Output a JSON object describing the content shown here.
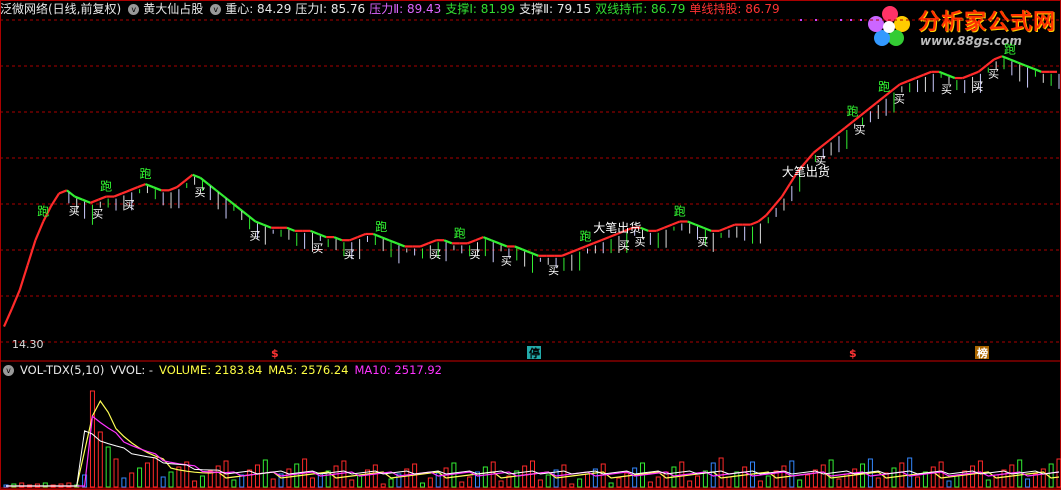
{
  "header": {
    "network_label": "泛微网络(日线,前复权)",
    "indicator_name": "黄大仙占股",
    "center_label": "重心: 84.29",
    "press1_label": "压力Ⅰ: 85.76",
    "press2_label": "压力Ⅱ: 89.43",
    "support1_label": "支撑Ⅰ: 81.99",
    "support2_label": "支撑Ⅱ: 79.15",
    "double_hold_label": "双线持币: 86.79",
    "single_hold_label": "单线持股: 86.79"
  },
  "logo": {
    "title": "分析家公式网",
    "url": "www.88gs.com"
  },
  "price_low_label": "14.30",
  "volume": {
    "name": "VOL-TDX(5,10)",
    "vvol": "VVOL: -",
    "volume_label": "VOLUME: 2183.84",
    "ma5_label": "MA5: 2576.24",
    "ma10_label": "MA10: 2517.92"
  },
  "markers": {
    "dollar": "$",
    "stop": "停",
    "rank": "榜"
  },
  "colors": {
    "up": "#ff2a2a",
    "down": "#33ee33",
    "ma_white": "#ffffff",
    "ma_yellow": "#ffff55",
    "ma_magenta": "#ff33ff",
    "grid": "#aa0000"
  },
  "chart_data": [
    {
      "type": "line",
      "title": "黄大仙占股",
      "ylabel": "",
      "series": [
        {
          "name": "黄大仙占股",
          "values": [
            14.3,
            20,
            26,
            34,
            42,
            48,
            53,
            57,
            58,
            56,
            55,
            54,
            55,
            56,
            56,
            57,
            58,
            59,
            60,
            59,
            58,
            58,
            59,
            61,
            63,
            62,
            60,
            58,
            56,
            54,
            52,
            50,
            48,
            47,
            46,
            46,
            46,
            45,
            45,
            45,
            44,
            43,
            43,
            42,
            42,
            43,
            44,
            44,
            43,
            42,
            41,
            40,
            40,
            40,
            41,
            42,
            42,
            41,
            41,
            41,
            42,
            43,
            42,
            41,
            40,
            40,
            39,
            38,
            37,
            37,
            37,
            37,
            38,
            39,
            40,
            41,
            42,
            43,
            44,
            45,
            46,
            46,
            45,
            45,
            46,
            47,
            48,
            48,
            47,
            46,
            45,
            45,
            46,
            47,
            47,
            47,
            48,
            50,
            53,
            56,
            60,
            64,
            67,
            70,
            72,
            74,
            76,
            78,
            80,
            82,
            84,
            86,
            88,
            90,
            92,
            93,
            94,
            95,
            96,
            96,
            95,
            94,
            94,
            95,
            96,
            98,
            100,
            101,
            100,
            99,
            98,
            97,
            96,
            96,
            96
          ]
        }
      ],
      "annotations": [
        "跑",
        "买",
        "大笔出货"
      ]
    },
    {
      "type": "bar",
      "title": "VOL-TDX(5,10)",
      "series": [
        {
          "name": "VOLUME",
          "values": [
            2183.84
          ]
        },
        {
          "name": "MA5",
          "values": [
            2576.24
          ]
        },
        {
          "name": "MA10",
          "values": [
            2517.92
          ]
        }
      ]
    }
  ]
}
